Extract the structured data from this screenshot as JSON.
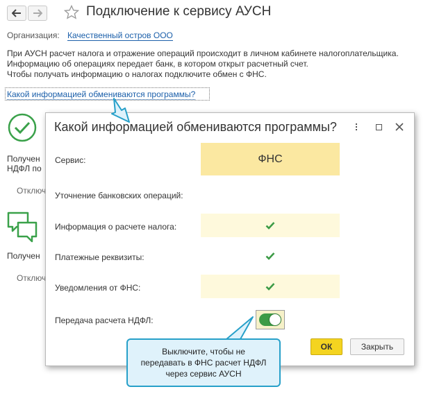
{
  "window": {
    "title": "Подключение к сервису АУСН",
    "nav": {
      "back_icon": "arrow-left-icon",
      "forward_icon": "arrow-right-icon",
      "favorite_icon": "star-icon"
    }
  },
  "organization": {
    "label": "Организация:",
    "value": "Качественный остров ООО"
  },
  "description": {
    "line1": "При АУСН расчет налога и отражение операций происходит в личном кабинете налогоплательщика.",
    "line2": "Информацию об операциях передает банк, в котором открыт расчетный счет.",
    "line3": "Чтобы получать информацию о налогах подключите обмен с ФНС."
  },
  "help_link": "Какой информацией обмениваются программы?",
  "background": {
    "item1_line1": "Получен",
    "item1_line2": "НДФЛ по",
    "item1_status": "Отключ",
    "item2_line1": "Получен",
    "item2_status": "Отключ"
  },
  "dialog": {
    "title": "Какой информацией обмениваются программы?",
    "column_header": "ФНС",
    "rows": [
      {
        "label": "Сервис:"
      },
      {
        "label": "Уточнение банковских операций:",
        "checked": false
      },
      {
        "label": "Информация о расчете налога:",
        "checked": true
      },
      {
        "label": "Платежные реквизиты:",
        "checked": true
      },
      {
        "label": "Уведомления от ФНС:",
        "checked": true
      },
      {
        "label": "Передача расчета НДФЛ:",
        "toggle_on": true
      }
    ],
    "ok_label": "ОК",
    "close_label": "Закрыть"
  },
  "tooltip": {
    "line1": "Выключите, чтобы не",
    "line2": "передавать в ФНС расчет НДФЛ",
    "line3": "через сервис АУСН"
  },
  "colors": {
    "link": "#1b5faa",
    "header_yellow": "#fbe8a1",
    "cell_yellow": "#fef9dc",
    "check_green": "#3c9b46",
    "ok_yellow": "#f4d420",
    "tooltip_border": "#27a0c9",
    "tooltip_fill": "#dff2fb"
  }
}
